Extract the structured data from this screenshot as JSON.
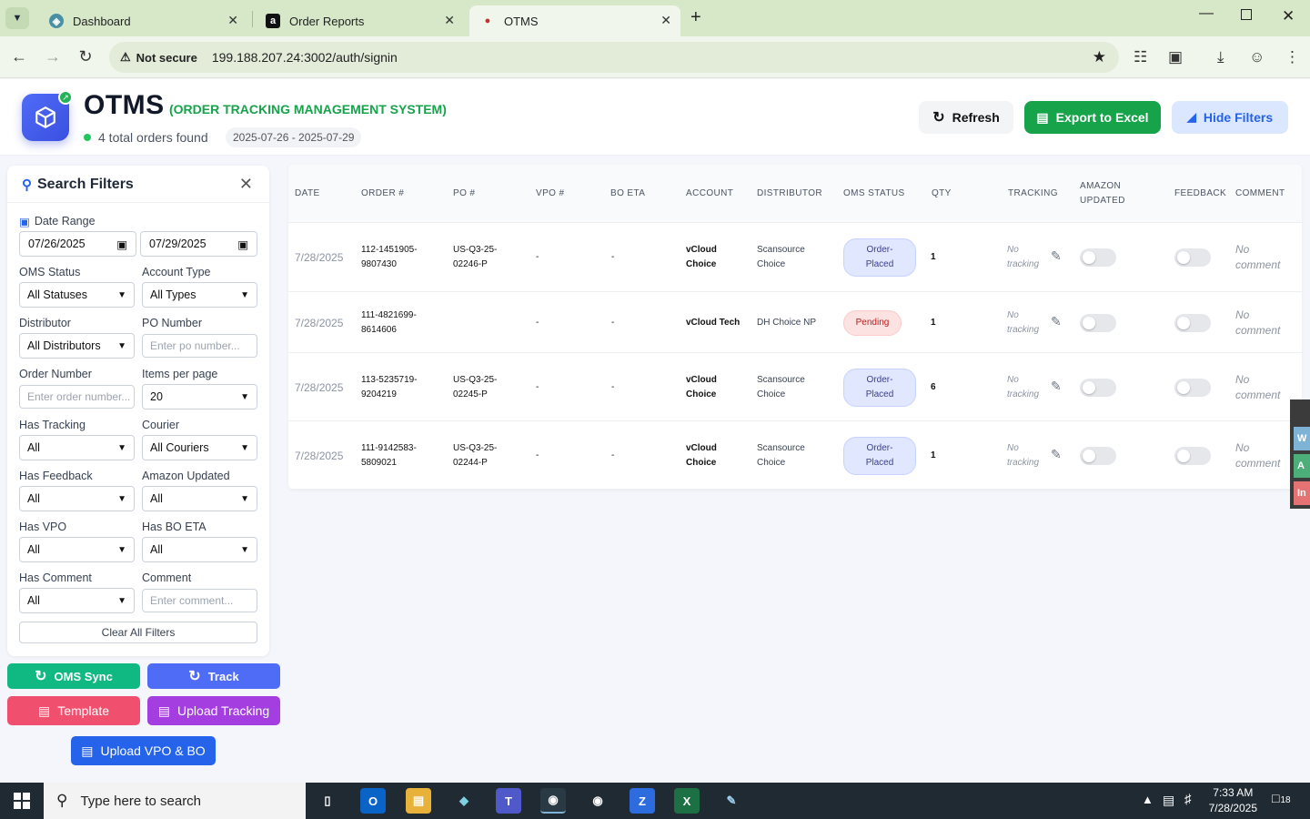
{
  "browser": {
    "tabs": [
      {
        "label": "Dashboard"
      },
      {
        "label": "Order Reports"
      },
      {
        "label": "OTMS"
      }
    ],
    "security_label": "Not secure",
    "url": "199.188.207.24:3002/auth/signin"
  },
  "header": {
    "title": "OTMS",
    "subtitle": "(ORDER TRACKING MANAGEMENT SYSTEM)",
    "order_count": "4 total orders found",
    "date_range": "2025-07-26 - 2025-07-29",
    "refresh_label": "Refresh",
    "export_label": "Export to Excel",
    "hide_filters_label": "Hide Filters"
  },
  "filters": {
    "title": "Search Filters",
    "date_range_label": "Date Range",
    "date_from": "07/26/2025",
    "date_to": "07/29/2025",
    "oms_status_label": "OMS Status",
    "oms_status_value": "All Statuses",
    "account_type_label": "Account Type",
    "account_type_value": "All Types",
    "distributor_label": "Distributor",
    "distributor_value": "All Distributors",
    "po_number_label": "PO Number",
    "po_number_placeholder": "Enter po number...",
    "order_number_label": "Order Number",
    "order_number_placeholder": "Enter order number...",
    "items_per_page_label": "Items per page",
    "items_per_page_value": "20",
    "has_tracking_label": "Has Tracking",
    "has_tracking_value": "All",
    "courier_label": "Courier",
    "courier_value": "All Couriers",
    "has_feedback_label": "Has Feedback",
    "has_feedback_value": "All",
    "amazon_updated_label": "Amazon Updated",
    "amazon_updated_value": "All",
    "has_vpo_label": "Has VPO",
    "has_vpo_value": "All",
    "has_bo_eta_label": "Has BO ETA",
    "has_bo_eta_value": "All",
    "has_comment_label": "Has Comment",
    "has_comment_value": "All",
    "comment_label": "Comment",
    "comment_placeholder": "Enter comment...",
    "clear_label": "Clear All Filters"
  },
  "actions": {
    "oms_sync": "OMS Sync",
    "track": "Track",
    "template": "Template",
    "upload_tracking": "Upload Tracking",
    "upload_vpo_bo": "Upload VPO & BO"
  },
  "table": {
    "columns": {
      "date": "DATE",
      "order": "ORDER #",
      "po": "PO #",
      "vpo": "VPO #",
      "bo_eta": "BO ETA",
      "account": "ACCOUNT",
      "distributor": "DISTRIBUTOR",
      "oms_status": "OMS STATUS",
      "qty": "QTY",
      "tracking": "TRACKING",
      "amazon_updated_1": "AMAZON",
      "amazon_updated_2": "UPDATED",
      "feedback": "FEEDBACK",
      "comment": "COMMENT"
    },
    "rows": [
      {
        "date": "7/28/2025",
        "order_1": "112-1451905-",
        "order_2": "9807430",
        "po_1": "US-Q3-25-",
        "po_2": "02246-P",
        "vpo": "-",
        "bo_eta": "-",
        "account_1": "vCloud",
        "account_2": "Choice",
        "dist_1": "Scansource",
        "dist_2": "Choice",
        "status_1": "Order-",
        "status_2": "Placed",
        "qty": "1",
        "tracking_1": "No",
        "tracking_2": "tracking",
        "amazon_updated": false,
        "feedback": false,
        "comment_1": "No",
        "comment_2": "comment"
      },
      {
        "date": "7/28/2025",
        "order_1": "111-4821699-",
        "order_2": "8614606",
        "po_1": "",
        "po_2": "",
        "vpo": "-",
        "bo_eta": "-",
        "account_1": "vCloud Tech",
        "account_2": "",
        "dist_1": "DH Choice NP",
        "dist_2": "",
        "status_1": "Pending",
        "status_2": "",
        "qty": "1",
        "tracking_1": "No",
        "tracking_2": "tracking",
        "amazon_updated": false,
        "feedback": false,
        "comment_1": "No",
        "comment_2": "comment"
      },
      {
        "date": "7/28/2025",
        "order_1": "113-5235719-",
        "order_2": "9204219",
        "po_1": "US-Q3-25-",
        "po_2": "02245-P",
        "vpo": "-",
        "bo_eta": "-",
        "account_1": "vCloud",
        "account_2": "Choice",
        "dist_1": "Scansource",
        "dist_2": "Choice",
        "status_1": "Order-",
        "status_2": "Placed",
        "qty": "6",
        "tracking_1": "No",
        "tracking_2": "tracking",
        "amazon_updated": false,
        "feedback": false,
        "comment_1": "No",
        "comment_2": "comment"
      },
      {
        "date": "7/28/2025",
        "order_1": "111-9142583-",
        "order_2": "5809021",
        "po_1": "US-Q3-25-",
        "po_2": "02244-P",
        "vpo": "-",
        "bo_eta": "-",
        "account_1": "vCloud",
        "account_2": "Choice",
        "dist_1": "Scansource",
        "dist_2": "Choice",
        "status_1": "Order-",
        "status_2": "Placed",
        "qty": "1",
        "tracking_1": "No",
        "tracking_2": "tracking",
        "amazon_updated": false,
        "feedback": false,
        "comment_1": "No",
        "comment_2": "comment"
      }
    ]
  },
  "side_widget": {
    "items": [
      "W",
      "A",
      "In"
    ]
  },
  "taskbar": {
    "search_placeholder": "Type here to search",
    "time": "7:33 AM",
    "date": "7/28/2025",
    "notification_count": "18"
  },
  "colors": {
    "brand_green": "#16a34a",
    "brand_blue": "#2563eb",
    "oms_sync": "#10b981",
    "track": "#4f6cf7",
    "template": "#f0506e",
    "upload_tracking": "#a43ee0",
    "upload_vpo": "#2563eb"
  }
}
